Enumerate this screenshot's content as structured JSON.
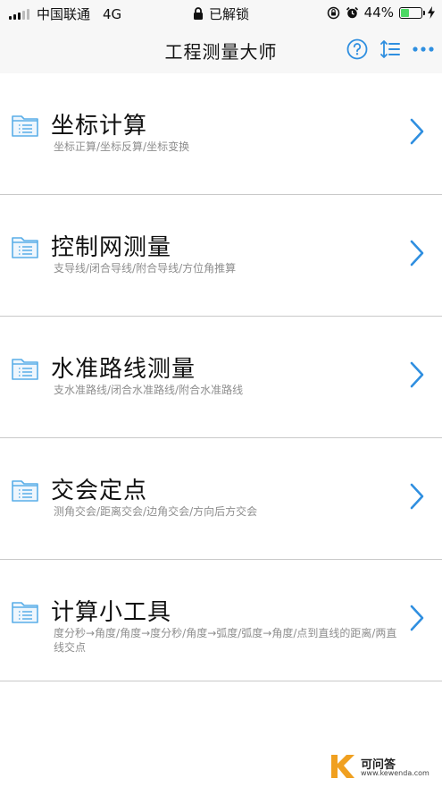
{
  "status_bar": {
    "carrier": "中国联通",
    "network": "4G",
    "lock_status": "已解锁",
    "battery": "44%",
    "battery_level": 0.44
  },
  "nav": {
    "title": "工程测量大师",
    "help_icon": "question-circle-icon",
    "sort_icon": "sort-list-icon",
    "more_icon": "ellipsis-icon",
    "accent_color": "#2f8fe0"
  },
  "menu": {
    "items": [
      {
        "title": "坐标计算",
        "subtitle": "坐标正算/坐标反算/坐标变换"
      },
      {
        "title": "控制网测量",
        "subtitle": "支导线/闭合导线/附合导线/方位角推算"
      },
      {
        "title": "水准路线测量",
        "subtitle": "支水准路线/闭合水准路线/附合水准路线"
      },
      {
        "title": "交会定点",
        "subtitle": "测角交会/距离交会/边角交会/方向后方交会"
      },
      {
        "title": "计算小工具",
        "subtitle": "度分秒→角度/角度→度分秒/角度→弧度/弧度→角度/点到直线的距离/两直线交点"
      }
    ]
  },
  "watermark": {
    "name": "可问答",
    "url": "www.kewenda.com"
  }
}
